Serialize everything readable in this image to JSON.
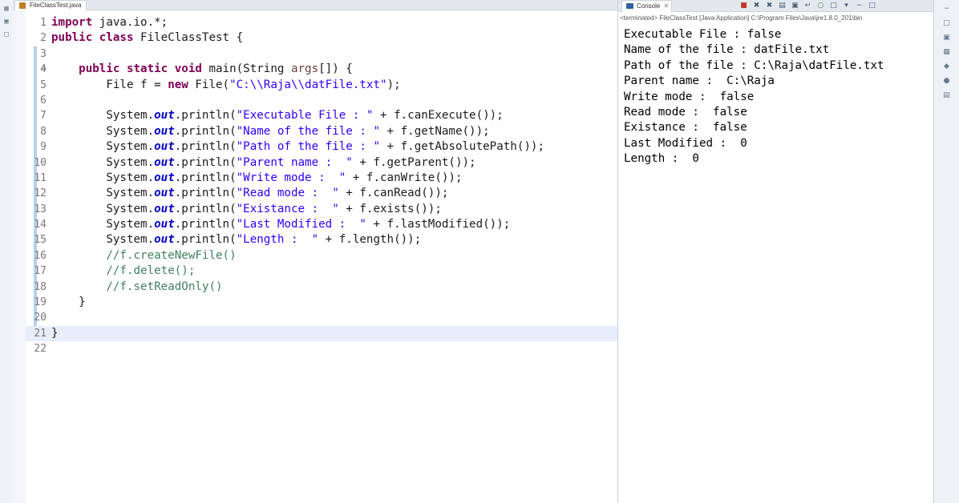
{
  "editor": {
    "tab_label": "FileClassTest.java",
    "lines": [
      {
        "n": "1",
        "mark": "",
        "tokens": [
          {
            "c": "kw",
            "t": "import"
          },
          {
            "c": "",
            "t": " java.io.*;"
          }
        ]
      },
      {
        "n": "2",
        "mark": "",
        "tokens": [
          {
            "c": "kw",
            "t": "public class"
          },
          {
            "c": "",
            "t": " FileClassTest {"
          }
        ]
      },
      {
        "n": "3",
        "mark": "",
        "tokens": []
      },
      {
        "n": "4",
        "mark": "⊖",
        "tokens": [
          {
            "c": "",
            "t": "    "
          },
          {
            "c": "kw",
            "t": "public static void"
          },
          {
            "c": "",
            "t": " main(String "
          },
          {
            "c": "vr",
            "t": "args"
          },
          {
            "c": "",
            "t": "[]) {"
          }
        ]
      },
      {
        "n": "5",
        "mark": "",
        "tokens": [
          {
            "c": "",
            "t": "        File f = "
          },
          {
            "c": "kw",
            "t": "new"
          },
          {
            "c": "",
            "t": " File("
          },
          {
            "c": "str",
            "t": "\"C:\\\\Raja\\\\datFile.txt\""
          },
          {
            "c": "",
            "t": ");"
          }
        ]
      },
      {
        "n": "6",
        "mark": "",
        "tokens": []
      },
      {
        "n": "7",
        "mark": "",
        "tokens": [
          {
            "c": "",
            "t": "        System."
          },
          {
            "c": "fld",
            "t": "out"
          },
          {
            "c": "",
            "t": ".println("
          },
          {
            "c": "str",
            "t": "\"Executable File : \""
          },
          {
            "c": "",
            "t": " + f.canExecute());"
          }
        ]
      },
      {
        "n": "8",
        "mark": "",
        "tokens": [
          {
            "c": "",
            "t": "        System."
          },
          {
            "c": "fld",
            "t": "out"
          },
          {
            "c": "",
            "t": ".println("
          },
          {
            "c": "str",
            "t": "\"Name of the file : \""
          },
          {
            "c": "",
            "t": " + f.getName());"
          }
        ]
      },
      {
        "n": "9",
        "mark": "",
        "tokens": [
          {
            "c": "",
            "t": "        System."
          },
          {
            "c": "fld",
            "t": "out"
          },
          {
            "c": "",
            "t": ".println("
          },
          {
            "c": "str",
            "t": "\"Path of the file : \""
          },
          {
            "c": "",
            "t": " + f.getAbsolutePath());"
          }
        ]
      },
      {
        "n": "10",
        "mark": "",
        "tokens": [
          {
            "c": "",
            "t": "        System."
          },
          {
            "c": "fld",
            "t": "out"
          },
          {
            "c": "",
            "t": ".println("
          },
          {
            "c": "str",
            "t": "\"Parent name :  \""
          },
          {
            "c": "",
            "t": " + f.getParent());"
          }
        ]
      },
      {
        "n": "11",
        "mark": "",
        "tokens": [
          {
            "c": "",
            "t": "        System."
          },
          {
            "c": "fld",
            "t": "out"
          },
          {
            "c": "",
            "t": ".println("
          },
          {
            "c": "str",
            "t": "\"Write mode :  \""
          },
          {
            "c": "",
            "t": " + f.canWrite());"
          }
        ]
      },
      {
        "n": "12",
        "mark": "",
        "tokens": [
          {
            "c": "",
            "t": "        System."
          },
          {
            "c": "fld",
            "t": "out"
          },
          {
            "c": "",
            "t": ".println("
          },
          {
            "c": "str",
            "t": "\"Read mode :  \""
          },
          {
            "c": "",
            "t": " + f.canRead());"
          }
        ]
      },
      {
        "n": "13",
        "mark": "",
        "tokens": [
          {
            "c": "",
            "t": "        System."
          },
          {
            "c": "fld",
            "t": "out"
          },
          {
            "c": "",
            "t": ".println("
          },
          {
            "c": "str",
            "t": "\"Existance :  \""
          },
          {
            "c": "",
            "t": " + f.exists());"
          }
        ]
      },
      {
        "n": "14",
        "mark": "",
        "tokens": [
          {
            "c": "",
            "t": "        System."
          },
          {
            "c": "fld",
            "t": "out"
          },
          {
            "c": "",
            "t": ".println("
          },
          {
            "c": "str",
            "t": "\"Last Modified :  \""
          },
          {
            "c": "",
            "t": " + f.lastModified());"
          }
        ]
      },
      {
        "n": "15",
        "mark": "",
        "tokens": [
          {
            "c": "",
            "t": "        System."
          },
          {
            "c": "fld",
            "t": "out"
          },
          {
            "c": "",
            "t": ".println("
          },
          {
            "c": "str",
            "t": "\"Length :  \""
          },
          {
            "c": "",
            "t": " + f.length());"
          }
        ]
      },
      {
        "n": "16",
        "mark": "",
        "tokens": [
          {
            "c": "",
            "t": "        "
          },
          {
            "c": "com",
            "t": "//f.createNewFile()"
          }
        ]
      },
      {
        "n": "17",
        "mark": "",
        "tokens": [
          {
            "c": "",
            "t": "        "
          },
          {
            "c": "com",
            "t": "//f.delete();"
          }
        ]
      },
      {
        "n": "18",
        "mark": "",
        "tokens": [
          {
            "c": "",
            "t": "        "
          },
          {
            "c": "com",
            "t": "//f.setReadOnly()"
          }
        ]
      },
      {
        "n": "19",
        "mark": "",
        "tokens": [
          {
            "c": "",
            "t": "    }"
          }
        ]
      },
      {
        "n": "20",
        "mark": "",
        "tokens": []
      },
      {
        "n": "21",
        "mark": "",
        "current": true,
        "tokens": [
          {
            "c": "",
            "t": "}"
          }
        ]
      },
      {
        "n": "22",
        "mark": "",
        "tokens": []
      }
    ]
  },
  "console": {
    "tab_label": "Console",
    "close_glyph": "✕",
    "terminated_text": "<terminated> FileClassTest [Java Application] C:\\Program Files\\Java\\jre1.8.0_201\\bin",
    "output": [
      "Executable File : false",
      "Name of the file : datFile.txt",
      "Path of the file : C:\\Raja\\datFile.txt",
      "Parent name :  C:\\Raja",
      "Write mode :  false",
      "Read mode :  false",
      "Existance :  false",
      "Last Modified :  0",
      "Length :  0"
    ],
    "toolbar": [
      {
        "name": "terminate-icon",
        "glyph": "■",
        "cls": "red"
      },
      {
        "name": "remove-launch-icon",
        "glyph": "✖",
        "cls": ""
      },
      {
        "name": "remove-all-icon",
        "glyph": "✖",
        "cls": ""
      },
      {
        "name": "clear-console-icon",
        "glyph": "▤",
        "cls": ""
      },
      {
        "name": "scroll-lock-icon",
        "glyph": "▣",
        "cls": ""
      },
      {
        "name": "word-wrap-icon",
        "glyph": "↵",
        "cls": ""
      },
      {
        "name": "pin-console-icon",
        "glyph": "○",
        "cls": "green"
      },
      {
        "name": "display-console-icon",
        "glyph": "□",
        "cls": ""
      },
      {
        "name": "open-console-icon",
        "glyph": "▾",
        "cls": ""
      },
      {
        "name": "minimize-icon",
        "glyph": "−",
        "cls": ""
      },
      {
        "name": "maximize-icon",
        "glyph": "□",
        "cls": ""
      }
    ]
  },
  "left_trim": [
    {
      "name": "trim-icon",
      "glyph": "▦"
    },
    {
      "name": "trim-icon",
      "glyph": "▣"
    },
    {
      "name": "trim-icon",
      "glyph": "□"
    }
  ],
  "right_trim": [
    {
      "name": "trim-icon",
      "glyph": "−"
    },
    {
      "name": "trim-icon",
      "glyph": "□"
    },
    {
      "name": "trim-icon",
      "glyph": "▣"
    },
    {
      "name": "trim-icon",
      "glyph": "▦"
    },
    {
      "name": "trim-icon",
      "glyph": "◆"
    },
    {
      "name": "trim-icon",
      "glyph": "●"
    },
    {
      "name": "trim-icon",
      "glyph": "▤"
    }
  ]
}
